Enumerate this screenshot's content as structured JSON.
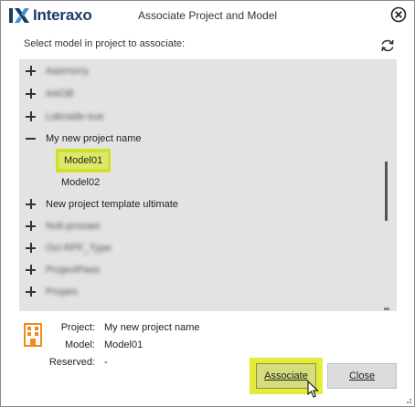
{
  "app": {
    "brand": "Interaxo",
    "title": "Associate Project and Model"
  },
  "subtitle": "Select model in project to associate:",
  "tree": {
    "items": [
      {
        "kind": "collapsed",
        "label": "Aasmorry",
        "obscured": true
      },
      {
        "kind": "collapsed",
        "label": "AAOB",
        "obscured": true
      },
      {
        "kind": "collapsed",
        "label": "Laknade-sue",
        "obscured": true
      },
      {
        "kind": "expanded",
        "label": "My new project name",
        "obscured": false
      },
      {
        "kind": "model",
        "label": "Model01",
        "selected": true
      },
      {
        "kind": "model",
        "label": "Model02",
        "selected": false
      },
      {
        "kind": "collapsed",
        "label": "New project template ultimate",
        "obscured": false
      },
      {
        "kind": "collapsed",
        "label": "Noli-prosaet",
        "obscured": true
      },
      {
        "kind": "collapsed",
        "label": "Ocl RPF_Type",
        "obscured": true
      },
      {
        "kind": "collapsed",
        "label": "ProjectPees",
        "obscured": true
      },
      {
        "kind": "collapsed",
        "label": "Propes",
        "obscured": true
      }
    ]
  },
  "details": {
    "project_label": "Project:",
    "project_value": "My new project name",
    "model_label": "Model:",
    "model_value": "Model01",
    "reserved_label": "Reserved:",
    "reserved_value": "-"
  },
  "buttons": {
    "associate": "Associate",
    "close": "Close"
  },
  "colors": {
    "highlight": "#dde86a",
    "brand_blue": "#1a3a6b",
    "building_icon": "#f08a1c"
  }
}
